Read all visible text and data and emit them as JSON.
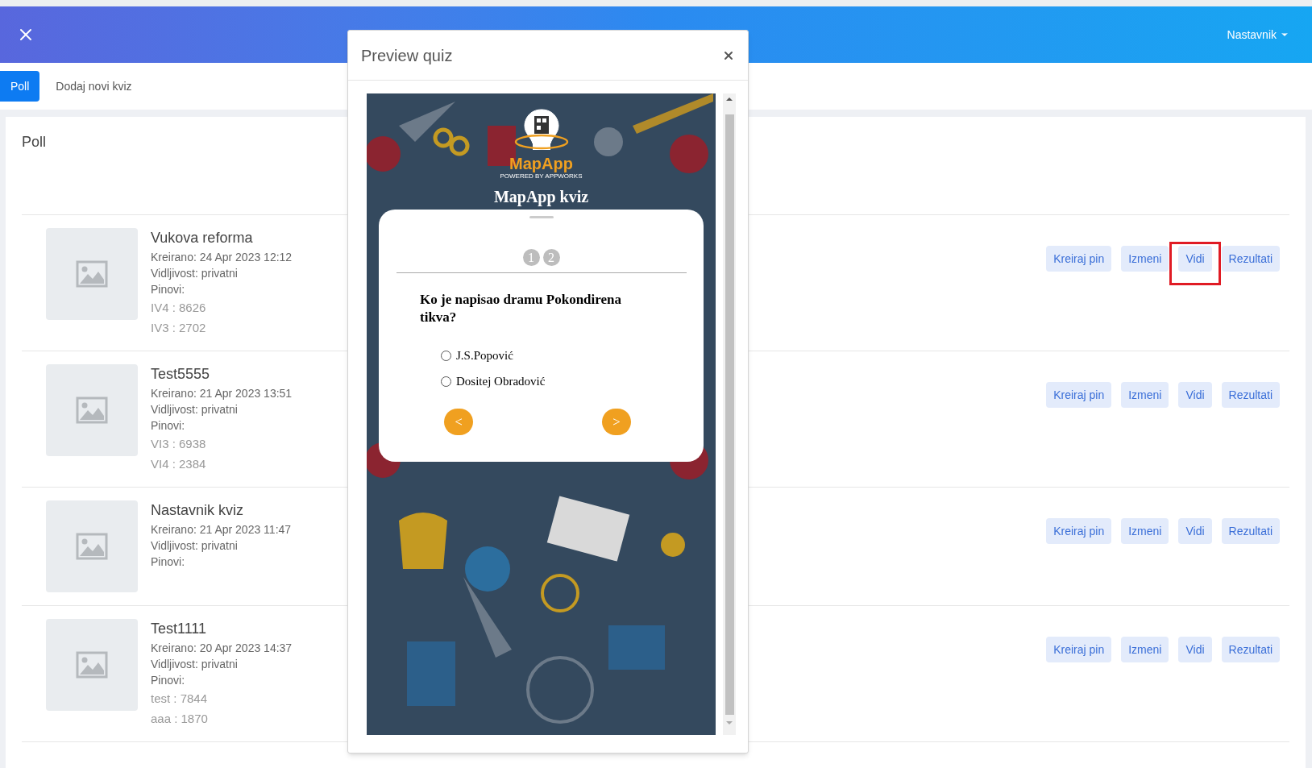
{
  "header": {
    "user_menu": "Nastavnik"
  },
  "tabs": [
    {
      "label": "Poll",
      "selected": true
    },
    {
      "label": "Dodaj novi kviz",
      "selected": false
    }
  ],
  "panel": {
    "title": "Poll"
  },
  "quizzes": [
    {
      "title": "Vukova reforma",
      "created": "Kreirano: 24 Apr 2023 12:12",
      "visibility": "Vidljivost: privatni",
      "pins_label": "Pinovi:",
      "pins": [
        "IV4 : 8626",
        "IV3 : 2702"
      ],
      "actions": [
        {
          "label": "Kreiraj pin",
          "highlighted": false
        },
        {
          "label": "Izmeni",
          "highlighted": false
        },
        {
          "label": "Vidi",
          "highlighted": true
        },
        {
          "label": "Rezultati",
          "highlighted": false
        }
      ]
    },
    {
      "title": "Test5555",
      "created": "Kreirano: 21 Apr 2023 13:51",
      "visibility": "Vidljivost: privatni",
      "pins_label": "Pinovi:",
      "pins": [
        "VI3 : 6938",
        "VI4 : 2384"
      ],
      "actions": [
        {
          "label": "Kreiraj pin",
          "highlighted": false
        },
        {
          "label": "Izmeni",
          "highlighted": false
        },
        {
          "label": "Vidi",
          "highlighted": false
        },
        {
          "label": "Rezultati",
          "highlighted": false
        }
      ]
    },
    {
      "title": "Nastavnik kviz",
      "created": "Kreirano: 21 Apr 2023 11:47",
      "visibility": "Vidljivost: privatni",
      "pins_label": "Pinovi:",
      "actions": [
        {
          "label": "Kreiraj pin",
          "highlighted": false
        },
        {
          "label": "Izmeni",
          "highlighted": false
        },
        {
          "label": "Vidi",
          "highlighted": false
        },
        {
          "label": "Rezultati",
          "highlighted": false
        }
      ]
    },
    {
      "title": "Test1111",
      "created": "Kreirano: 20 Apr 2023 14:37",
      "visibility": "Vidljivost: privatni",
      "pins_label": "Pinovi:",
      "pins": [
        "test : 7844",
        "aaa : 1870"
      ],
      "actions": [
        {
          "label": "Kreiraj pin",
          "highlighted": false
        },
        {
          "label": "Izmeni",
          "highlighted": false
        },
        {
          "label": "Vidi",
          "highlighted": false
        },
        {
          "label": "Rezultati",
          "highlighted": false
        }
      ]
    }
  ],
  "modal": {
    "title": "Preview quiz",
    "quiz": {
      "brand": "MapApp",
      "brand_tagline": "POWERED BY APPWORKS",
      "title": "MapApp kviz",
      "steps": [
        "1",
        "2"
      ],
      "question": "Ko je napisao dramu Pokondirena tikva?",
      "options": [
        {
          "label": "J.S.Popović",
          "selected": false
        },
        {
          "label": "Dositej Obradović",
          "selected": false
        }
      ],
      "prev": "<",
      "next": ">"
    }
  }
}
